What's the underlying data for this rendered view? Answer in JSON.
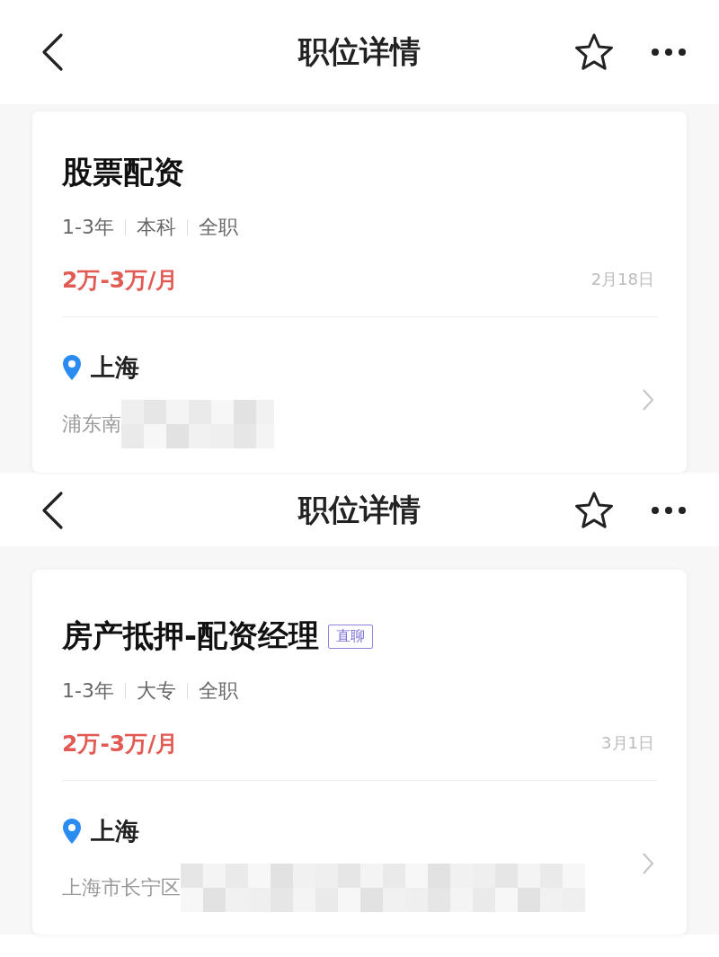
{
  "screens": [
    {
      "header": {
        "title": "职位详情"
      },
      "job": {
        "title": "股票配资",
        "tags": [
          "1-3年",
          "本科",
          "全职"
        ],
        "salary": "2万-3万/月",
        "date": "2月18日",
        "city": "上海",
        "address": "浦东南"
      }
    },
    {
      "header": {
        "title": "职位详情"
      },
      "job": {
        "title": "房产抵押-配资经理",
        "badge": "直聊",
        "tags": [
          "1-3年",
          "大专",
          "全职"
        ],
        "salary": "2万-3万/月",
        "date": "3月1日",
        "city": "上海",
        "address": "上海市长宁区"
      }
    }
  ]
}
